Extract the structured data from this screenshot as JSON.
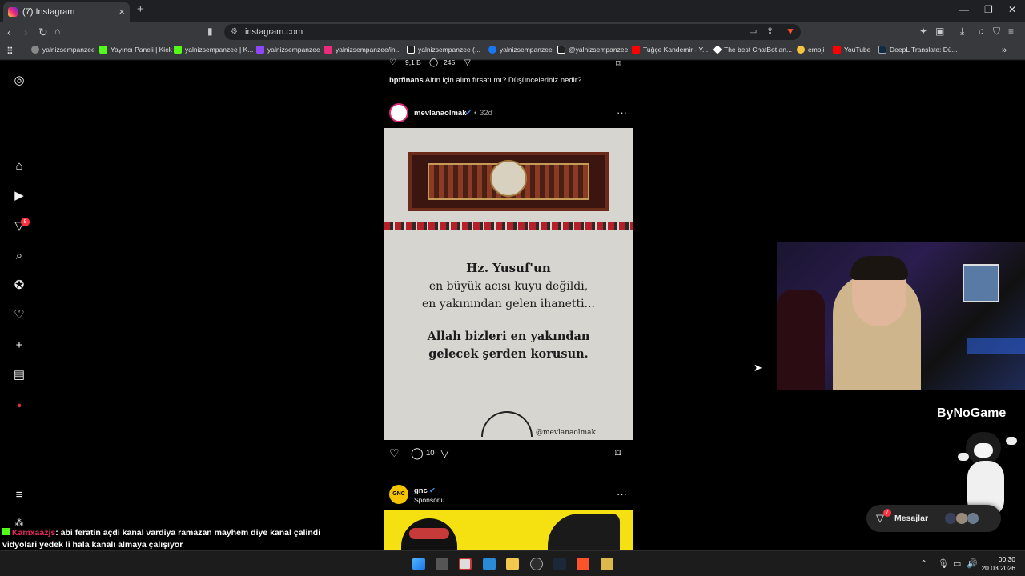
{
  "browser": {
    "tab_title": "(7) Instagram",
    "tab_close": "×",
    "new_tab": "+",
    "url": "instagram.com",
    "bookmarks": [
      {
        "label": "yalnizsempanzee",
        "color": "#888888"
      },
      {
        "label": "Yayıncı Paneli | Kick",
        "color": "#53fc18"
      },
      {
        "label": "yalnizsempanzee | K...",
        "color": "#53fc18"
      },
      {
        "label": "yalnizsempanzee",
        "color": "#9146ff"
      },
      {
        "label": "yalnizsempanzee/in...",
        "color": "#ee2a7b"
      },
      {
        "label": "yalnizsempanzee (...",
        "color": "#222222"
      },
      {
        "label": "yalnizsempanzee",
        "color": "#1877f2"
      },
      {
        "label": "@yalnizsempanzee",
        "color": "#222222"
      },
      {
        "label": "Tuğçe Kandemir - Y...",
        "color": "#ff0000"
      },
      {
        "label": "The best ChatBot an...",
        "color": "#ffffff"
      },
      {
        "label": "emoji",
        "color": "#f5c542"
      },
      {
        "label": "YouTube",
        "color": "#ff0000"
      },
      {
        "label": "DeepL Translate: Dü...",
        "color": "#0f2b46"
      }
    ]
  },
  "sidebar": {
    "notifications_badge": "8"
  },
  "feed": {
    "prev_post": {
      "likes": "9,1 B",
      "comments": "245",
      "caption_user": "bptfinans",
      "caption_text": "Altın için alım fırsatı mı? Düşünceleriniz nedir?"
    },
    "post": {
      "username": "mevlanaolmak",
      "time": "32d",
      "verse_title": "Hz. Yusuf'un",
      "verse_line1": "en büyük acısı kuyu değildi,",
      "verse_line2": "en yakınından gelen ihanetti...",
      "verse_line3": "Allah bizleri en yakından",
      "verse_line4": "gelecek şerden korusun.",
      "watermark": "@mevlanaolmak",
      "comments": "10"
    },
    "next_post": {
      "username": "gnc",
      "sponsored": "Sponsorlu",
      "avatar_text": "GNC"
    }
  },
  "overlay": {
    "brand": "ByNoGame",
    "messages_label": "Mesajlar",
    "messages_badge": "7",
    "chat_user": "Kamxaazjs",
    "chat_text": ": abi feratin açdi kanal vardiya ramazan mayhem diye kanal çalindi vidyolari yedek li hala kanalı almaya çalışıyor"
  },
  "taskbar": {
    "time": "00:30",
    "date": "20.03.2026"
  }
}
